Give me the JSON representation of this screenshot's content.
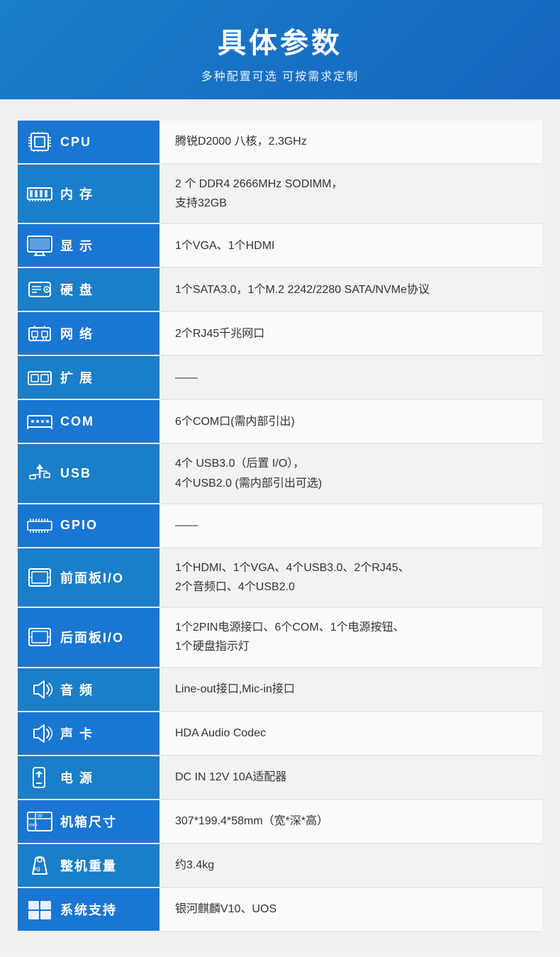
{
  "header": {
    "title": "具体参数",
    "subtitle": "多种配置可选 可按需求定制"
  },
  "specs": [
    {
      "id": "cpu",
      "icon": "cpu",
      "label": "CPU",
      "value": "腾锐D2000 八核，2.3GHz",
      "multiline": false
    },
    {
      "id": "memory",
      "icon": "memory",
      "label": "内 存",
      "value": "2 个 DDR4 2666MHz SODIMM，\n支持32GB",
      "multiline": true
    },
    {
      "id": "display",
      "icon": "display",
      "label": "显 示",
      "value": "1个VGA、1个HDMI",
      "multiline": false
    },
    {
      "id": "storage",
      "icon": "storage",
      "label": "硬 盘",
      "value": "1个SATA3.0，1个M.2 2242/2280 SATA/NVMe协议",
      "multiline": false
    },
    {
      "id": "network",
      "icon": "network",
      "label": "网 络",
      "value": "2个RJ45千兆网口",
      "multiline": false
    },
    {
      "id": "expand",
      "icon": "expand",
      "label": "扩 展",
      "value": "——",
      "multiline": false,
      "dash": true
    },
    {
      "id": "com",
      "icon": "com",
      "label": "COM",
      "value": "6个COM口(需内部引出)",
      "multiline": false
    },
    {
      "id": "usb",
      "icon": "usb",
      "label": "USB",
      "value": "4个 USB3.0（后置 I/O），\n4个USB2.0 (需内部引出可选)",
      "multiline": true
    },
    {
      "id": "gpio",
      "icon": "gpio",
      "label": "GPIO",
      "value": "——",
      "multiline": false,
      "dash": true
    },
    {
      "id": "front-io",
      "icon": "panel",
      "label": "前面板I/O",
      "value": "1个HDMI、1个VGA、4个USB3.0、2个RJ45、\n2个音频口、4个USB2.0",
      "multiline": true
    },
    {
      "id": "rear-io",
      "icon": "panel",
      "label": "后面板I/O",
      "value": "1个2PIN电源接口、6个COM、1个电源按钮、\n1个硬盘指示灯",
      "multiline": true
    },
    {
      "id": "audio",
      "icon": "audio",
      "label": "音 频",
      "value": "Line-out接口,Mic-in接口",
      "multiline": false
    },
    {
      "id": "soundcard",
      "icon": "audio",
      "label": "声 卡",
      "value": "HDA Audio Codec",
      "multiline": false
    },
    {
      "id": "power",
      "icon": "power",
      "label": "电 源",
      "value": "DC IN 12V 10A适配器",
      "multiline": false
    },
    {
      "id": "size",
      "icon": "size",
      "label": "机箱尺寸",
      "value": "307*199.4*58mm（宽*深*高）",
      "multiline": false
    },
    {
      "id": "weight",
      "icon": "weight",
      "label": "整机重量",
      "value": "约3.4kg",
      "multiline": false
    },
    {
      "id": "os",
      "icon": "os",
      "label": "系统支持",
      "value": "银河麒麟V10、UOS",
      "multiline": false
    }
  ]
}
